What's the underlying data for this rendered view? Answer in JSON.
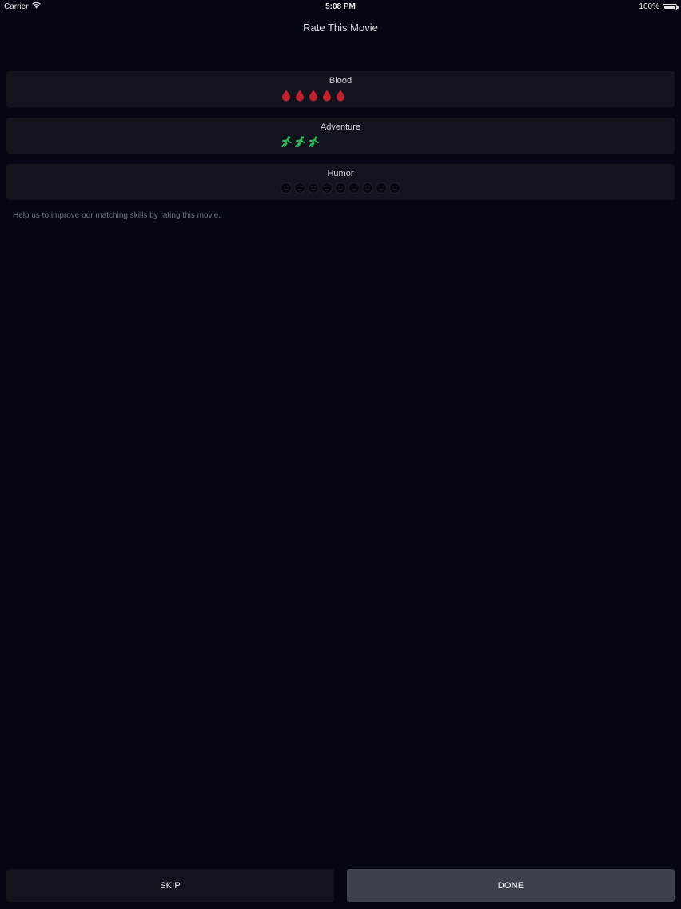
{
  "status_bar": {
    "carrier": "Carrier",
    "time": "5:08 PM",
    "battery": "100%"
  },
  "header": {
    "title": "Rate This Movie"
  },
  "ratings": [
    {
      "label": "Blood",
      "icon": "blood-drop-icon",
      "value": 5,
      "max": 9,
      "active_color": "#c0212a",
      "inactive_color": "#12151e"
    },
    {
      "label": "Adventure",
      "icon": "runner-icon",
      "value": 3,
      "max": 9,
      "active_color": "#2fb35a",
      "inactive_color": "#12151e"
    },
    {
      "label": "Humor",
      "icon": "laughing-face-icon",
      "value": 0,
      "max": 9,
      "active_color": "#e8c030",
      "inactive_color": "#04060d"
    }
  ],
  "help_text": "Help us to improve our matching skills by rating this movie.",
  "buttons": {
    "skip": "SKIP",
    "done": "DONE"
  }
}
